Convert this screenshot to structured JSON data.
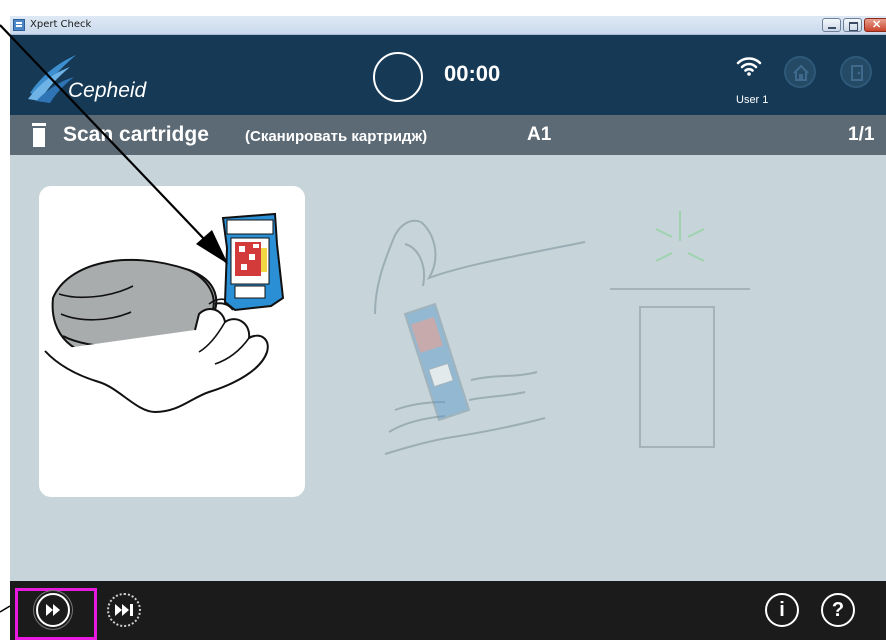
{
  "window": {
    "title": "Xpert Check"
  },
  "header": {
    "brand": "Cepheid",
    "timer": "00:00",
    "user": "User 1",
    "icons": [
      "wifi-icon",
      "home-icon",
      "exit-door-icon"
    ]
  },
  "step": {
    "title": "Scan cartridge",
    "subtitle": "(Сканировать картридж)",
    "position": "A1",
    "count": "1/1"
  },
  "bottom": {
    "icons": [
      "fast-forward-icon",
      "skip-to-end-icon",
      "info-icon",
      "help-icon"
    ],
    "info_glyph": "i",
    "help_glyph": "?"
  },
  "colors": {
    "header": "#163a56",
    "step_bar": "#5c6a75",
    "content_bg": "#c7d5da",
    "bottom_bar": "#1b1b1b",
    "highlight": "#e81adf"
  }
}
